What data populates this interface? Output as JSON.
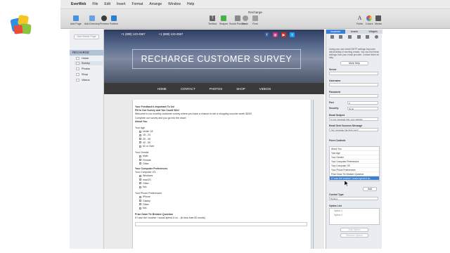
{
  "menubar": {
    "app": "EverWeb",
    "items": [
      "File",
      "Edit",
      "Insert",
      "Format",
      "Arrange",
      "Window",
      "Help"
    ]
  },
  "window": {
    "title": "Recharge"
  },
  "toolbar": {
    "left": [
      "Add Page",
      "Add Directory",
      "Preview",
      "Publish"
    ],
    "center": [
      "Textbox",
      "Shapes",
      "Social Position",
      "Circle",
      "Flow"
    ],
    "right": [
      "Fonts",
      "Colors",
      "Media"
    ]
  },
  "leftpanel": {
    "new_master": "New Master Page",
    "site": "RECHARGE",
    "pages": [
      {
        "label": "Home",
        "selected": false
      },
      {
        "label": "Survey",
        "selected": true
      },
      {
        "label": "Photos",
        "selected": false
      },
      {
        "label": "Shop",
        "selected": false
      },
      {
        "label": "Videos",
        "selected": false
      }
    ]
  },
  "hero": {
    "phone1": "+1 (888) 123-4567",
    "phone2": "+1 (888) 123-4567",
    "title": "RECHARGE CUSTOMER SURVEY"
  },
  "nav": [
    "HOME",
    "CONTACT",
    "PHOTOS",
    "SHOP",
    "VIDEOS"
  ],
  "form": {
    "intro1": "Your Feedback's Important To Us!",
    "intro2": "Fill In Our Survey and You Could Win!",
    "intro3": "Welcome to our monthly customer survey where you have a chance to win a shopping voucher worth $200!",
    "intro4": "Complete our survey and you go into the draw!",
    "about": "About You",
    "age_label": "Your Age",
    "ages": [
      "Under 18",
      "18 - 24",
      "25 - 39",
      "40 - 59",
      "60 or Over"
    ],
    "gender_label": "Your Gender",
    "genders": [
      "Male",
      "Female",
      "Other"
    ],
    "computer_pref": "Your Computer Preferences",
    "computer_os": "Your Computer OS",
    "oses": [
      "Windows",
      "macOS",
      "Other",
      "N/a"
    ],
    "phone_pref": "Your Phone Preferences",
    "phones": [
      "iPhone",
      "Galaxy",
      "Other",
      "N/a"
    ],
    "tiebreak": "Prize Draw Tie Breaker Question",
    "tiebreak_q": "If I won the voucher I would spend it on... (in less than 50 words)"
  },
  "inspector": {
    "tabs": [
      "Inspector",
      "Assets",
      "Widgets"
    ],
    "desc": "Using your own email SMTP settings improves deliverability of sending emails. You can find these settings from your email provider. Contact them for help.",
    "more_help": "More Help",
    "server": "Server",
    "username": "Username",
    "password": "Password",
    "port_label": "Port",
    "port": "0",
    "security": "Security",
    "security_val": "None",
    "email_subject": "Email Subject",
    "email_subject_val": "A new message from your website",
    "email_sent": "Email Sent Success Message",
    "email_sent_val": "Your message has been sent!",
    "form_controls": "Form Controls",
    "controls": [
      "About You",
      "Your Age",
      "Your Gender",
      "Your Computer Preferences",
      "Your Computer OS",
      "Your Phone Preferences",
      "Prize Draw Tie Breaker Question",
      "If I won the voucher I would spend it on..."
    ],
    "selected_control": 7,
    "add": "Add",
    "control_type": "Control Type",
    "control_type_val": "Textbox",
    "option_list": "Option List",
    "options": [
      "Option 1",
      "Option 2"
    ],
    "add_option": "Add Option",
    "remove_option": "Remove Option"
  },
  "colors": {
    "accent": "#3d7fd1",
    "nav": "#3a3a3a",
    "hero": "#3e4c6e"
  }
}
